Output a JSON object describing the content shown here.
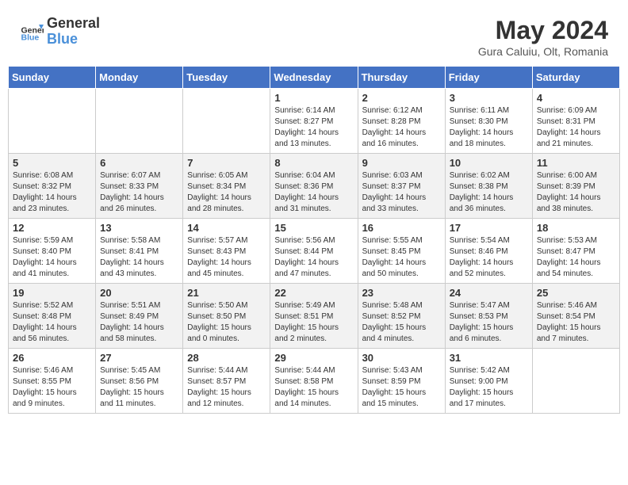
{
  "header": {
    "logo_general": "General",
    "logo_blue": "Blue",
    "month_year": "May 2024",
    "location": "Gura Caluiu, Olt, Romania"
  },
  "days_of_week": [
    "Sunday",
    "Monday",
    "Tuesday",
    "Wednesday",
    "Thursday",
    "Friday",
    "Saturday"
  ],
  "weeks": [
    [
      {
        "day": "",
        "info": ""
      },
      {
        "day": "",
        "info": ""
      },
      {
        "day": "",
        "info": ""
      },
      {
        "day": "1",
        "info": "Sunrise: 6:14 AM\nSunset: 8:27 PM\nDaylight: 14 hours\nand 13 minutes."
      },
      {
        "day": "2",
        "info": "Sunrise: 6:12 AM\nSunset: 8:28 PM\nDaylight: 14 hours\nand 16 minutes."
      },
      {
        "day": "3",
        "info": "Sunrise: 6:11 AM\nSunset: 8:30 PM\nDaylight: 14 hours\nand 18 minutes."
      },
      {
        "day": "4",
        "info": "Sunrise: 6:09 AM\nSunset: 8:31 PM\nDaylight: 14 hours\nand 21 minutes."
      }
    ],
    [
      {
        "day": "5",
        "info": "Sunrise: 6:08 AM\nSunset: 8:32 PM\nDaylight: 14 hours\nand 23 minutes."
      },
      {
        "day": "6",
        "info": "Sunrise: 6:07 AM\nSunset: 8:33 PM\nDaylight: 14 hours\nand 26 minutes."
      },
      {
        "day": "7",
        "info": "Sunrise: 6:05 AM\nSunset: 8:34 PM\nDaylight: 14 hours\nand 28 minutes."
      },
      {
        "day": "8",
        "info": "Sunrise: 6:04 AM\nSunset: 8:36 PM\nDaylight: 14 hours\nand 31 minutes."
      },
      {
        "day": "9",
        "info": "Sunrise: 6:03 AM\nSunset: 8:37 PM\nDaylight: 14 hours\nand 33 minutes."
      },
      {
        "day": "10",
        "info": "Sunrise: 6:02 AM\nSunset: 8:38 PM\nDaylight: 14 hours\nand 36 minutes."
      },
      {
        "day": "11",
        "info": "Sunrise: 6:00 AM\nSunset: 8:39 PM\nDaylight: 14 hours\nand 38 minutes."
      }
    ],
    [
      {
        "day": "12",
        "info": "Sunrise: 5:59 AM\nSunset: 8:40 PM\nDaylight: 14 hours\nand 41 minutes."
      },
      {
        "day": "13",
        "info": "Sunrise: 5:58 AM\nSunset: 8:41 PM\nDaylight: 14 hours\nand 43 minutes."
      },
      {
        "day": "14",
        "info": "Sunrise: 5:57 AM\nSunset: 8:43 PM\nDaylight: 14 hours\nand 45 minutes."
      },
      {
        "day": "15",
        "info": "Sunrise: 5:56 AM\nSunset: 8:44 PM\nDaylight: 14 hours\nand 47 minutes."
      },
      {
        "day": "16",
        "info": "Sunrise: 5:55 AM\nSunset: 8:45 PM\nDaylight: 14 hours\nand 50 minutes."
      },
      {
        "day": "17",
        "info": "Sunrise: 5:54 AM\nSunset: 8:46 PM\nDaylight: 14 hours\nand 52 minutes."
      },
      {
        "day": "18",
        "info": "Sunrise: 5:53 AM\nSunset: 8:47 PM\nDaylight: 14 hours\nand 54 minutes."
      }
    ],
    [
      {
        "day": "19",
        "info": "Sunrise: 5:52 AM\nSunset: 8:48 PM\nDaylight: 14 hours\nand 56 minutes."
      },
      {
        "day": "20",
        "info": "Sunrise: 5:51 AM\nSunset: 8:49 PM\nDaylight: 14 hours\nand 58 minutes."
      },
      {
        "day": "21",
        "info": "Sunrise: 5:50 AM\nSunset: 8:50 PM\nDaylight: 15 hours\nand 0 minutes."
      },
      {
        "day": "22",
        "info": "Sunrise: 5:49 AM\nSunset: 8:51 PM\nDaylight: 15 hours\nand 2 minutes."
      },
      {
        "day": "23",
        "info": "Sunrise: 5:48 AM\nSunset: 8:52 PM\nDaylight: 15 hours\nand 4 minutes."
      },
      {
        "day": "24",
        "info": "Sunrise: 5:47 AM\nSunset: 8:53 PM\nDaylight: 15 hours\nand 6 minutes."
      },
      {
        "day": "25",
        "info": "Sunrise: 5:46 AM\nSunset: 8:54 PM\nDaylight: 15 hours\nand 7 minutes."
      }
    ],
    [
      {
        "day": "26",
        "info": "Sunrise: 5:46 AM\nSunset: 8:55 PM\nDaylight: 15 hours\nand 9 minutes."
      },
      {
        "day": "27",
        "info": "Sunrise: 5:45 AM\nSunset: 8:56 PM\nDaylight: 15 hours\nand 11 minutes."
      },
      {
        "day": "28",
        "info": "Sunrise: 5:44 AM\nSunset: 8:57 PM\nDaylight: 15 hours\nand 12 minutes."
      },
      {
        "day": "29",
        "info": "Sunrise: 5:44 AM\nSunset: 8:58 PM\nDaylight: 15 hours\nand 14 minutes."
      },
      {
        "day": "30",
        "info": "Sunrise: 5:43 AM\nSunset: 8:59 PM\nDaylight: 15 hours\nand 15 minutes."
      },
      {
        "day": "31",
        "info": "Sunrise: 5:42 AM\nSunset: 9:00 PM\nDaylight: 15 hours\nand 17 minutes."
      },
      {
        "day": "",
        "info": ""
      }
    ]
  ]
}
